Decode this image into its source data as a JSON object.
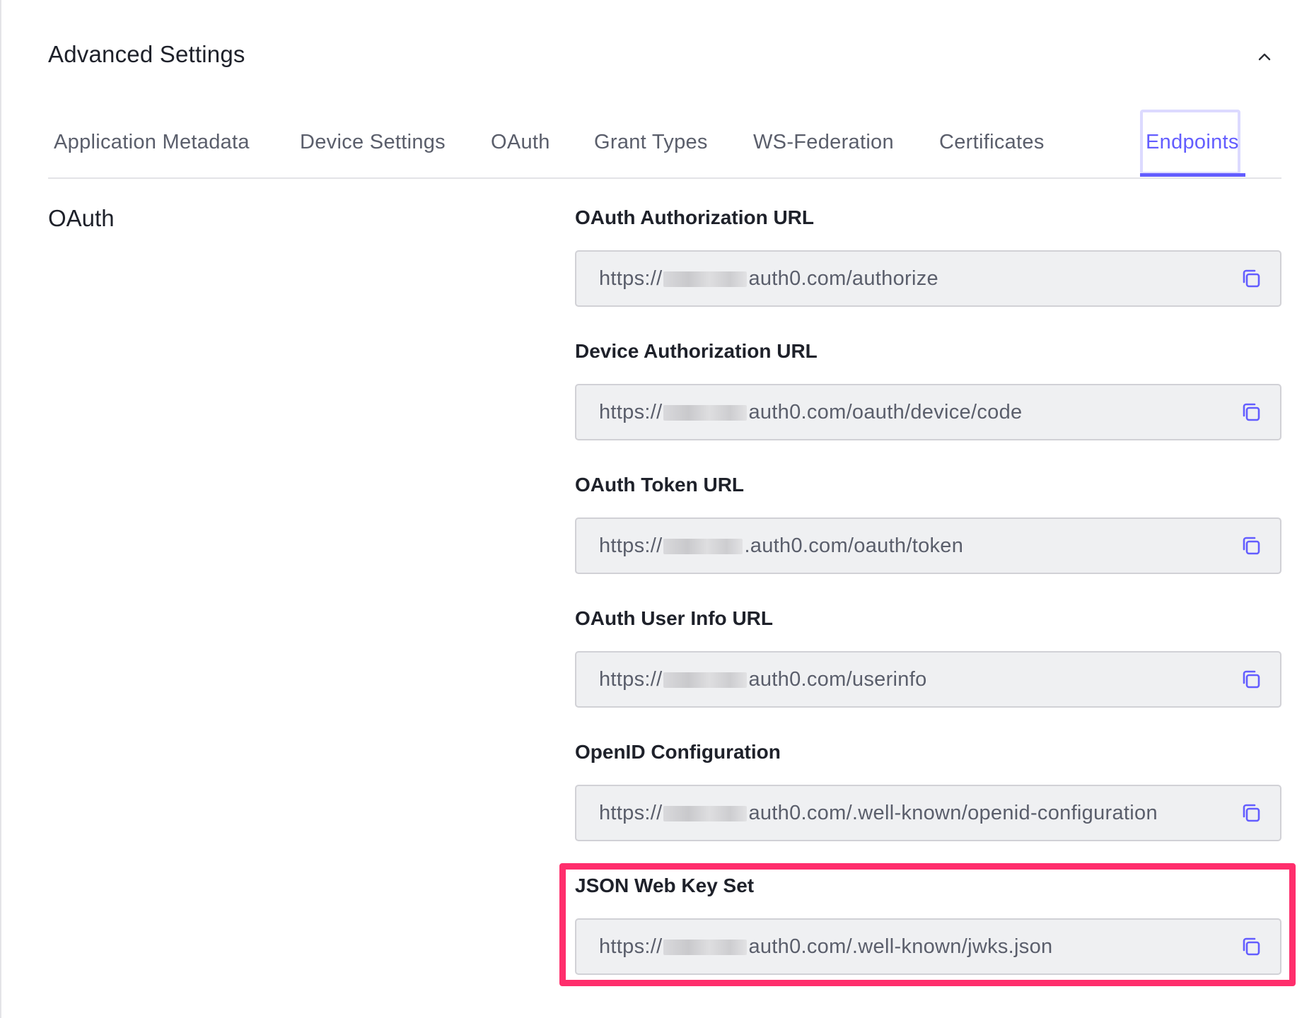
{
  "header": {
    "title": "Advanced Settings",
    "collapse_icon": "chevron-up-icon"
  },
  "tabs": [
    {
      "label": "Application Metadata",
      "active": false
    },
    {
      "label": "Device Settings",
      "active": false
    },
    {
      "label": "OAuth",
      "active": false
    },
    {
      "label": "Grant Types",
      "active": false
    },
    {
      "label": "WS-Federation",
      "active": false
    },
    {
      "label": "Certificates",
      "active": false
    },
    {
      "label": "Endpoints",
      "active": true
    }
  ],
  "section": {
    "title": "OAuth"
  },
  "fields": [
    {
      "label": "OAuth Authorization URL",
      "prefix": "https://",
      "suffix": "auth0.com/authorize"
    },
    {
      "label": "Device Authorization URL",
      "prefix": "https://",
      "suffix": "auth0.com/oauth/device/code"
    },
    {
      "label": "OAuth Token URL",
      "prefix": "https://",
      "suffix": ".auth0.com/oauth/token"
    },
    {
      "label": "OAuth User Info URL",
      "prefix": "https://",
      "suffix": "auth0.com/userinfo"
    },
    {
      "label": "OpenID Configuration",
      "prefix": "https://",
      "suffix": "auth0.com/.well-known/openid-configuration"
    },
    {
      "label": "JSON Web Key Set",
      "prefix": "https://",
      "suffix": "auth0.com/.well-known/jwks.json"
    }
  ],
  "colors": {
    "accent": "#635dff",
    "highlight": "#ff2e6c",
    "field_bg": "#eff0f2",
    "text_primary": "#1e212a",
    "text_secondary": "#5a5e6b"
  },
  "icons": {
    "copy": "copy-icon"
  }
}
